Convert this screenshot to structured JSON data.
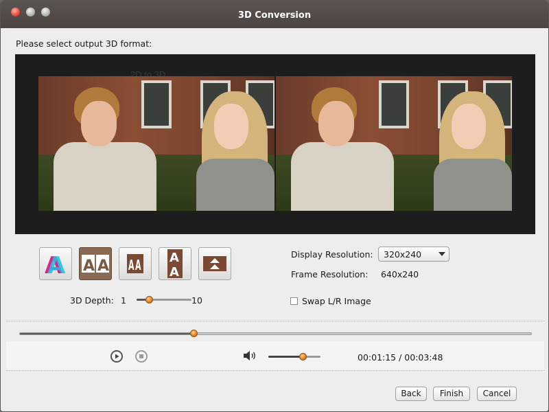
{
  "window": {
    "title": "3D Conversion"
  },
  "main": {
    "prompt": "Please select output 3D format:",
    "ghost_text": {
      "option": "2D to 3D"
    }
  },
  "formats": [
    {
      "name": "anaglyph",
      "selected": false
    },
    {
      "name": "side-by-side-full",
      "selected": true
    },
    {
      "name": "side-by-side-half",
      "selected": false
    },
    {
      "name": "top-bottom-full",
      "selected": false
    },
    {
      "name": "top-bottom-half",
      "selected": false
    }
  ],
  "depth": {
    "label": "3D Depth:",
    "min_label": "1",
    "max_label": "10",
    "min": 1,
    "max": 10,
    "value": 3
  },
  "resolution": {
    "display_label": "Display Resolution:",
    "display_value": "320x240",
    "frame_label": "Frame Resolution:",
    "frame_value": "640x240"
  },
  "swap": {
    "label": "Swap L/R Image",
    "checked": false
  },
  "playback": {
    "progress": 0.34,
    "volume": 0.66,
    "time": "00:01:15 / 00:03:48"
  },
  "buttons": {
    "back": "Back",
    "finish": "Finish",
    "cancel": "Cancel"
  },
  "colors": {
    "accent": "#e0801c",
    "selected_format": "#8a6a52"
  }
}
